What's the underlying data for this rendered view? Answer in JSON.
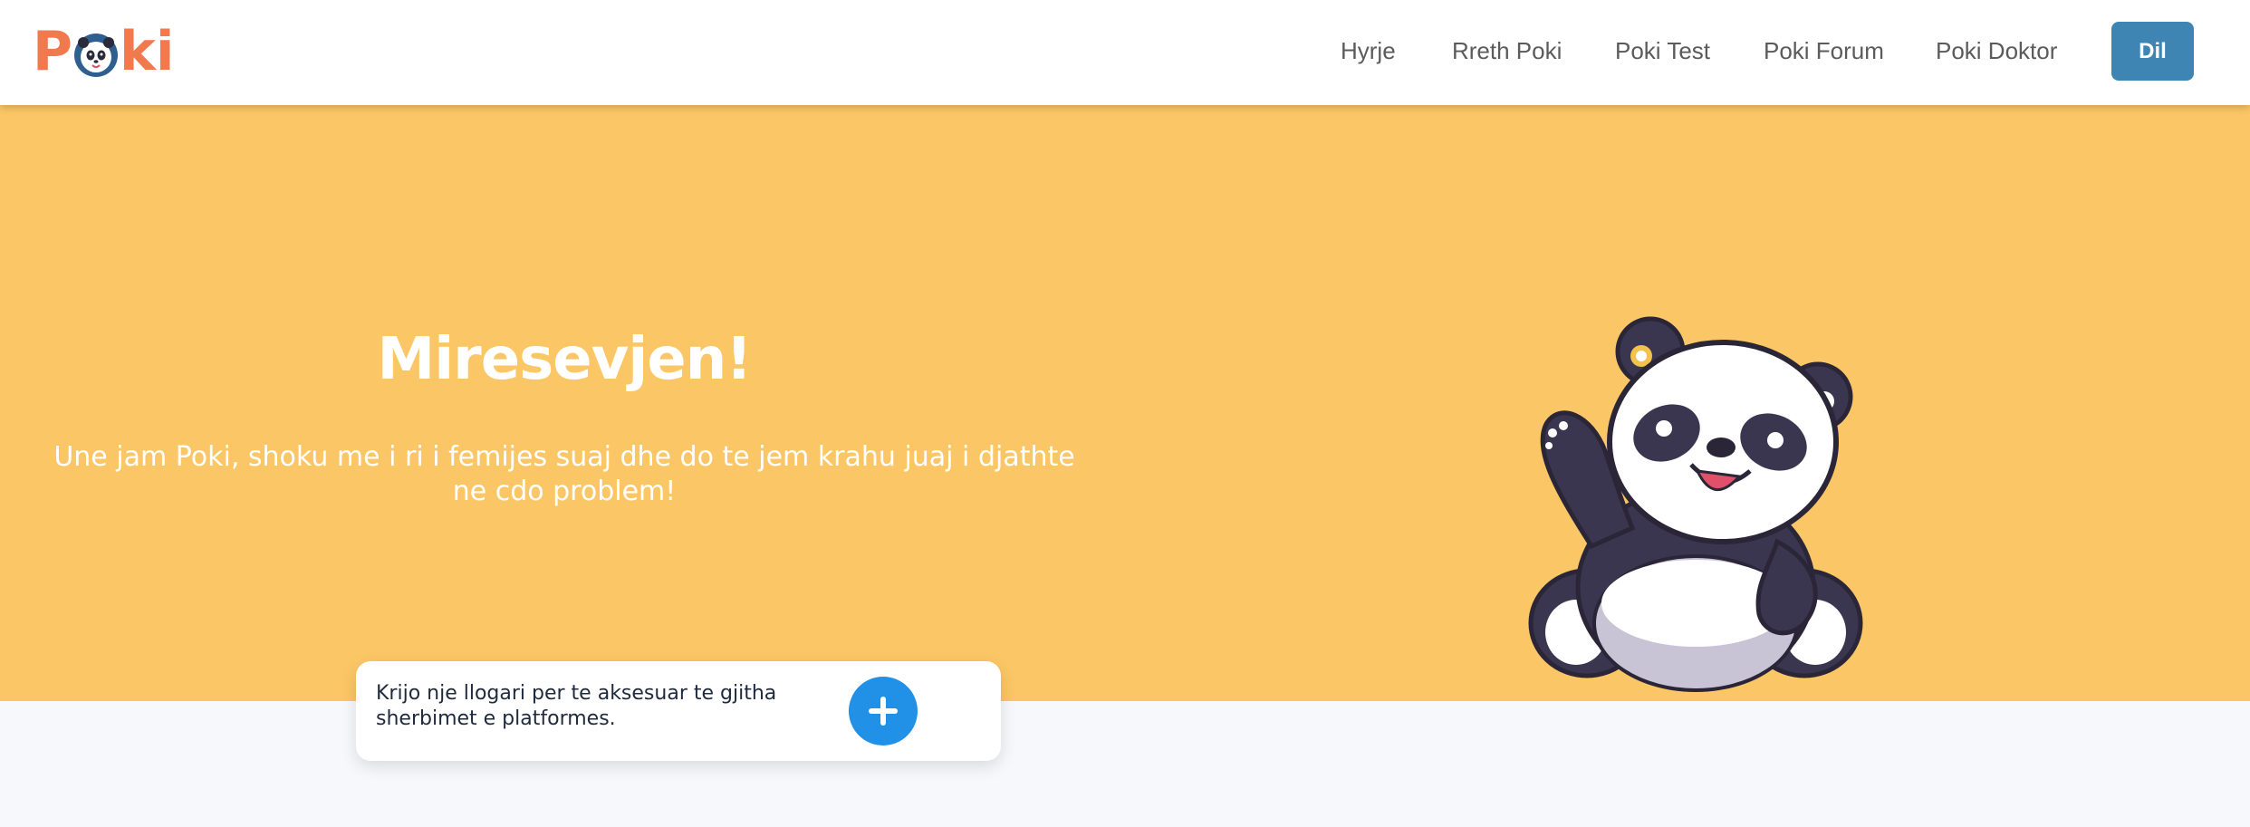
{
  "header": {
    "logo": {
      "text_before": "P",
      "text_after": "ki",
      "icon": "panda-face-icon"
    },
    "nav": {
      "hyrje": "Hyrje",
      "rreth": "Rreth Poki",
      "test": "Poki Test",
      "forum": "Poki Forum",
      "doktor": "Poki Doktor"
    },
    "dil_button": "Dil"
  },
  "hero": {
    "title": "Miresevjen!",
    "subtitle": "Une jam Poki, shoku me i ri i femijes suaj dhe do te jem krahu juaj i djathte ne cdo problem!",
    "illustration": "waving-panda-illustration"
  },
  "cta": {
    "text": "Krijo nje llogari per te aksesuar te gjitha sherbimet e platformes.",
    "button_icon": "plus-icon"
  },
  "colors": {
    "hero_bg": "#fbc665",
    "logo": "#f07a4e",
    "dil_button": "#3f85b4",
    "plus_button": "#2191e8",
    "page_bg": "#f7f8fb"
  }
}
